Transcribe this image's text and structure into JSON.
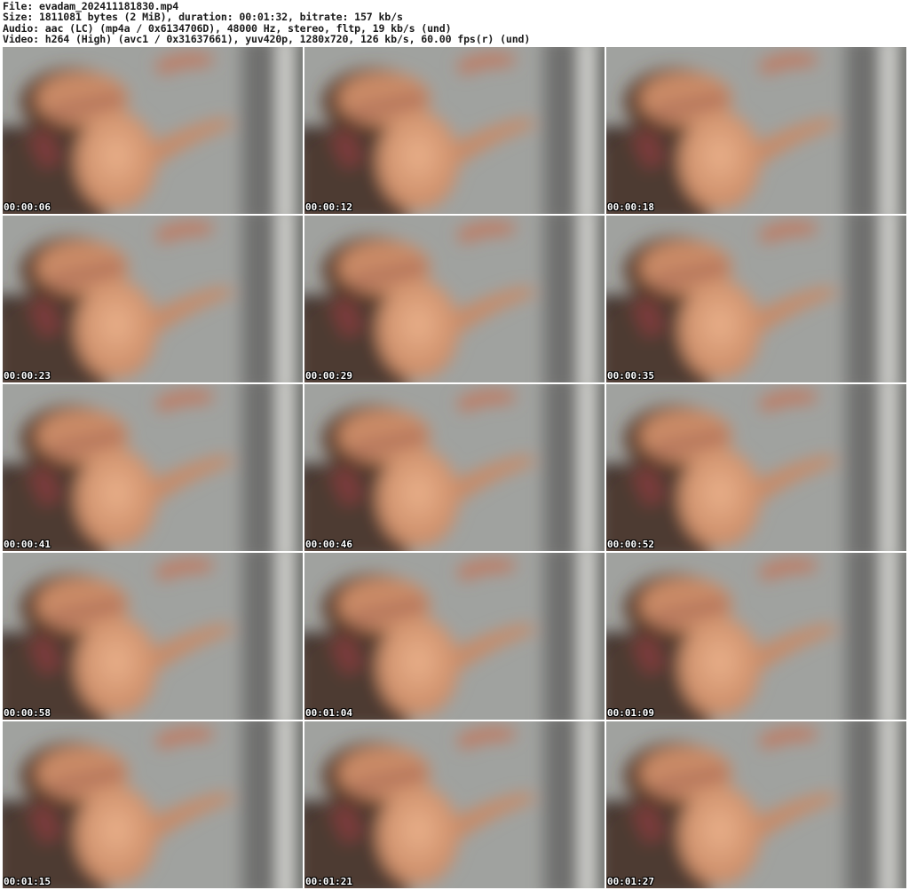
{
  "header": {
    "file_line": "File: evadam_202411181830.mp4",
    "size_line": "Size: 1811081 bytes (2 MiB), duration: 00:01:32, bitrate: 157 kb/s",
    "audio_line": "Audio: aac (LC) (mp4a / 0x6134706D), 48000 Hz, stereo, fltp, 19 kb/s (und)",
    "video_line": "Video: h264 (High) (avc1 / 0x31637661), yuv420p, 1280x720, 126 kb/s, 60.00 fps(r) (und)"
  },
  "frames": [
    {
      "time": "00:00:06"
    },
    {
      "time": "00:00:12"
    },
    {
      "time": "00:00:18"
    },
    {
      "time": "00:00:23"
    },
    {
      "time": "00:00:29"
    },
    {
      "time": "00:00:35"
    },
    {
      "time": "00:00:41"
    },
    {
      "time": "00:00:46"
    },
    {
      "time": "00:00:52"
    },
    {
      "time": "00:00:58"
    },
    {
      "time": "00:01:04"
    },
    {
      "time": "00:01:09"
    },
    {
      "time": "00:01:15"
    },
    {
      "time": "00:01:21"
    },
    {
      "time": "00:01:27"
    }
  ],
  "colors": {
    "background": "#ffffff",
    "header_text": "#1a1a1a",
    "timestamp_text": "#ffffff",
    "frame_wall": "#a0a29f",
    "frame_dark": "#3a2e2a",
    "skin_light": "#e9b08a",
    "skin_mid": "#c98a66",
    "hair": "#5a3a2c"
  }
}
